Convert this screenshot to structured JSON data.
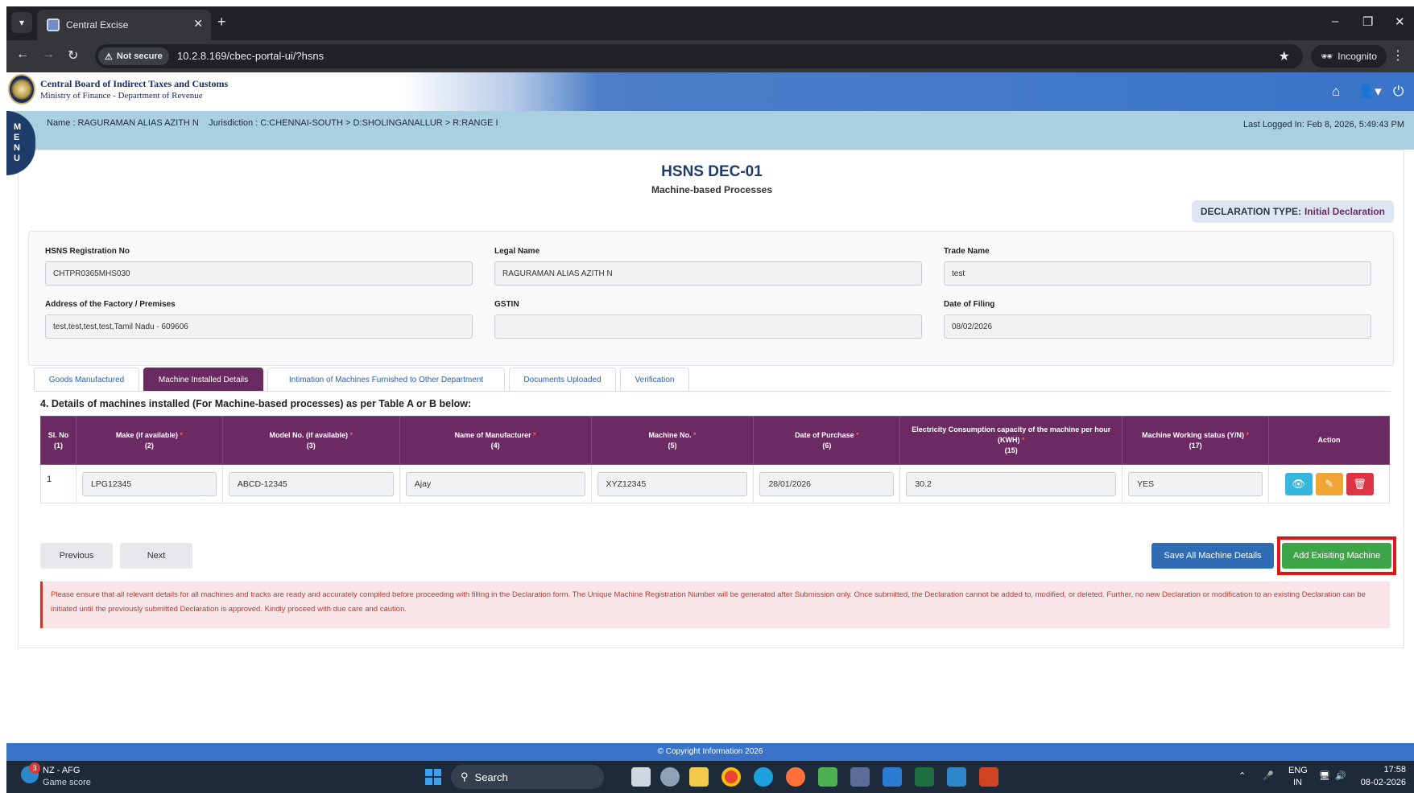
{
  "browser": {
    "tab_title": "Central Excise",
    "not_secure": "Not secure",
    "url": "10.2.8.169/cbec-portal-ui/?hsns",
    "incognito": "Incognito"
  },
  "header": {
    "org_name": "Central Board of Indirect Taxes and Customs",
    "org_sub": "Ministry of Finance - Department of Revenue"
  },
  "infobar": {
    "user": "Name : RAGURAMAN ALIAS AZITH N    Jurisdiction : C:CHENNAI-SOUTH > D:SHOLINGANALLUR > R:RANGE I",
    "last_login": "Last Logged In: Feb 8, 2026, 5:49:43 PM",
    "menu_letters": [
      "M",
      "E",
      "N",
      "U"
    ]
  },
  "page": {
    "title": "HSNS DEC-01",
    "subtitle": "Machine-based Processes",
    "declaration_label": "DECLARATION TYPE:",
    "declaration_value": "Initial Declaration"
  },
  "form": {
    "reg_label": "HSNS Registration No",
    "reg_value": "CHTPR0365MHS030",
    "legal_label": "Legal Name",
    "legal_value": "RAGURAMAN ALIAS AZITH N",
    "trade_label": "Trade Name",
    "trade_value": "test",
    "address_label": "Address of the Factory / Premises",
    "address_value": "test,test,test,test,Tamil Nadu - 609606",
    "gstin_label": "GSTIN",
    "gstin_value": "",
    "date_label": "Date of Filing",
    "date_value": "08/02/2026"
  },
  "tabs": [
    "Goods Manufactured",
    "Machine Installed Details",
    "Intimation of Machines Furnished to Other Department",
    "Documents Uploaded",
    "Verification"
  ],
  "section_heading": "4. Details of machines installed (For Machine-based processes) as per Table A or B below:",
  "table": {
    "headers": [
      {
        "label": "Sl. No",
        "num": "(1)"
      },
      {
        "label": "Make (if available)",
        "num": "(2)"
      },
      {
        "label": "Model No. (if available)",
        "num": "(3)"
      },
      {
        "label": "Name of Manufacturer",
        "num": "(4)"
      },
      {
        "label": "Machine No.",
        "num": "(5)"
      },
      {
        "label": "Date of Purchase",
        "num": "(6)"
      },
      {
        "label": "Electricity Consumption capacity of the machine per hour (KWH)",
        "num": "(15)"
      },
      {
        "label": "Machine Working status (Y/N)",
        "num": "(17)"
      },
      {
        "label": "Action",
        "num": ""
      }
    ],
    "required_mark": "*",
    "row": {
      "sl": "1",
      "make": "LPG12345",
      "model": "ABCD-12345",
      "manufacturer": "Ajay",
      "machine_no": "XYZ12345",
      "purchase_date": "28/01/2026",
      "kwh": "30.2",
      "status": "YES"
    }
  },
  "buttons": {
    "previous": "Previous",
    "next": "Next",
    "save_all": "Save All Machine Details",
    "add_existing": "Add Exisiting Machine"
  },
  "notice": "Please ensure that all relevant details for all machines and tracks are ready and accurately compiled before proceeding with filling in the Declaration form. The Unique Machine Registration Number will be generated after Submission only. Once submitted, the Declaration cannot be added to, modified, or deleted. Further, no new Declaration or modification to an existing Declaration can be initiated until the previously submitted Declaration is approved. Kindly proceed with due care and caution.",
  "footer": "© Copyright Information 2026",
  "taskbar": {
    "weather_badge": "3",
    "weather_title": "NZ - AFG",
    "weather_sub": "Game score",
    "search": "Search",
    "lang1": "ENG",
    "lang2": "IN",
    "time": "17:58",
    "date": "08-02-2026"
  },
  "colors": {
    "brand_purple": "#6c2a63",
    "header_blue": "#3a74c8",
    "save_blue": "#2f6cb3",
    "add_green": "#3da447",
    "highlight_red": "#e01515"
  }
}
